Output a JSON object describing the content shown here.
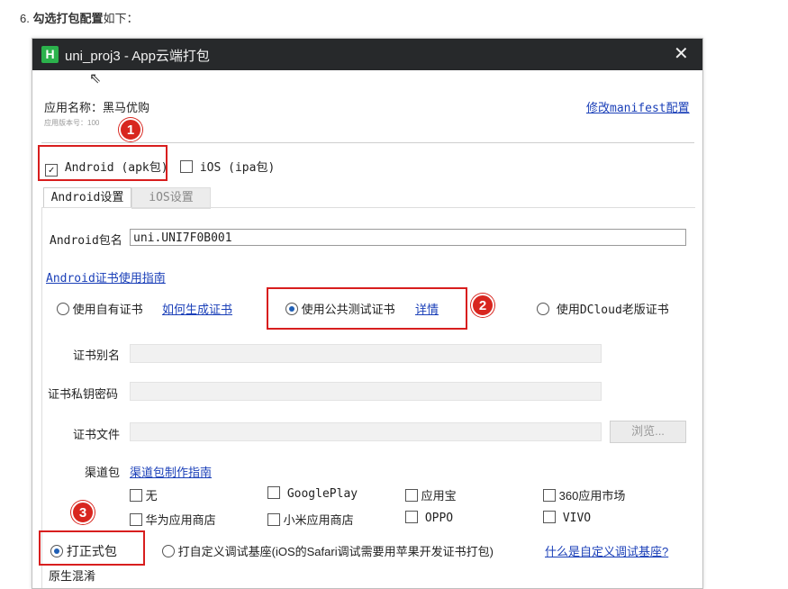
{
  "step": {
    "number": "6.",
    "bold": "勾选打包配置",
    "rest": "如下："
  },
  "dialog": {
    "icon": "H",
    "title": "uni_proj3 - App云端打包",
    "close": "✕",
    "app_name_label": "应用名称：黑马优购",
    "version_label": "应用版本号：100",
    "modify_manifest": "修改manifest配置",
    "platforms": {
      "android": {
        "label": "Android (apk包)",
        "checked": true
      },
      "ios": {
        "label": "iOS (ipa包)",
        "checked": false
      }
    },
    "tabs": [
      "Android设置",
      "iOS设置"
    ],
    "package_name_label": "Android包名",
    "package_name_value": "uni.UNI7F0B001",
    "cert_guide_link": "Android证书使用指南",
    "cert_options": [
      {
        "label": "使用自有证书",
        "link": "如何生成证书",
        "selected": false
      },
      {
        "label": "使用公共测试证书",
        "link": "详情",
        "selected": true
      },
      {
        "label": "使用DCloud老版证书",
        "selected": false
      }
    ],
    "cert_alias_label": "证书别名",
    "cert_password_label": "证书私钥密码",
    "cert_file_label": "证书文件",
    "browse_button": "浏览...",
    "channel_label": "渠道包",
    "channel_guide_link": "渠道包制作指南",
    "channels": [
      "无",
      "GooglePlay",
      "应用宝",
      "360应用市场",
      "华为应用商店",
      "小米应用商店",
      "OPPO",
      "VIVO"
    ],
    "build_options": [
      {
        "label": "打正式包",
        "selected": true
      },
      {
        "label": "打自定义调试基座(iOS的Safari调试需要用苹果开发证书打包)",
        "selected": false
      }
    ],
    "custom_base_link": "什么是自定义调试基座?",
    "native_obfuscation": "原生混淆"
  },
  "badges": [
    "1",
    "2",
    "3"
  ],
  "colors": {
    "titlebar": "#27292b",
    "highlight_red": "#d81e1e",
    "link_blue": "#1a3fb8",
    "app_icon_green": "#2bb24c"
  }
}
